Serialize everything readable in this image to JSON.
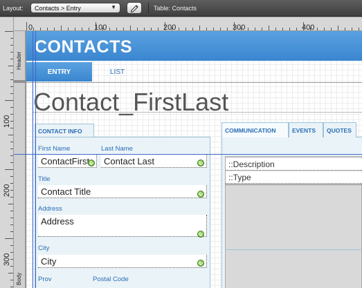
{
  "toolbar": {
    "layout_label": "Layout:",
    "layout_value": "Contacts > Entry",
    "table_label": "Table: Contacts"
  },
  "ruler": {
    "top_numbers": [
      "0",
      "100",
      "200",
      "300",
      "400"
    ],
    "left_numbers": [
      "100",
      "200",
      "300"
    ]
  },
  "parts": {
    "header": "Header",
    "body": "Body"
  },
  "header": {
    "title": "CONTACTS",
    "tabs": [
      "ENTRY",
      "LIST"
    ]
  },
  "layout_title": "Contact_FirstLast",
  "contact_info": {
    "tab": "CONTACT INFO",
    "fields": {
      "first_name": {
        "label": "First Name",
        "value": "ContactFirst"
      },
      "last_name": {
        "label": "Last Name",
        "value": "Contact Last"
      },
      "title": {
        "label": "Title",
        "value": "Contact Title"
      },
      "address": {
        "label": "Address",
        "value": "Address"
      },
      "city": {
        "label": "City",
        "value": "City"
      },
      "prov": {
        "label": "Prov"
      },
      "postal_code": {
        "label": "Postal Code"
      }
    }
  },
  "right_tabs": [
    "COMMUNICATION",
    "EVENTS",
    "QUOTES"
  ],
  "portal_rows": [
    "::Description",
    "::Type"
  ],
  "colors": {
    "header_blue": "#3a86cf",
    "label_blue": "#2a6db5",
    "panel_bg": "#eaf3f8",
    "guide_blue": "#3e69c9"
  }
}
